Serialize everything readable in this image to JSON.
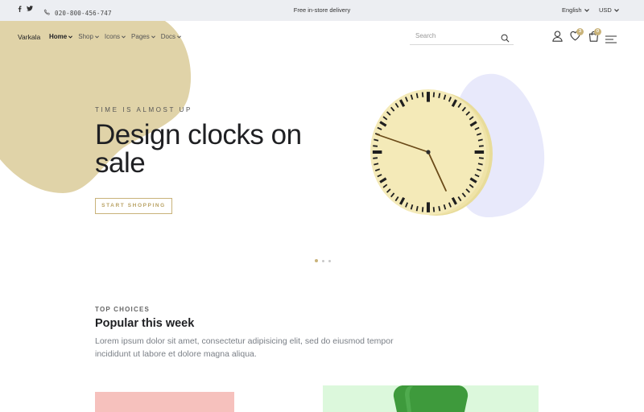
{
  "topbar": {
    "social": [
      "facebook-icon",
      "twitter-icon"
    ],
    "phone": "020-800-456-747",
    "promo": "Free in-store delivery",
    "language": "English",
    "currency": "USD"
  },
  "header": {
    "logo": "Varkala",
    "nav": [
      {
        "label": "Home",
        "active": true
      },
      {
        "label": "Shop",
        "active": false
      },
      {
        "label": "Icons",
        "active": false
      },
      {
        "label": "Pages",
        "active": false
      },
      {
        "label": "Docs",
        "active": false
      }
    ],
    "search_placeholder": "Search",
    "wishlist_count": "3",
    "cart_count": "0"
  },
  "hero": {
    "eyebrow": "TIME IS ALMOST UP",
    "title": "Design clocks on sale",
    "cta": "START SHOPPING",
    "slides": 3,
    "active_slide": 1
  },
  "section": {
    "kicker": "TOP CHOICES",
    "title": "Popular this week",
    "description": "Lorem ipsum dolor sit amet, consectetur adipisicing elit, sed do eiusmod tempor incididunt ut labore et dolore magna aliqua."
  },
  "colors": {
    "accent": "#c9b37a",
    "blob_beige": "#e0d3a8",
    "blob_lavender": "#e8e9fb",
    "clock_face": "#f4eab8",
    "card_pink": "#f6c1bd",
    "card_green": "#dcf8dc",
    "bottle_green": "#3e9a3c"
  }
}
